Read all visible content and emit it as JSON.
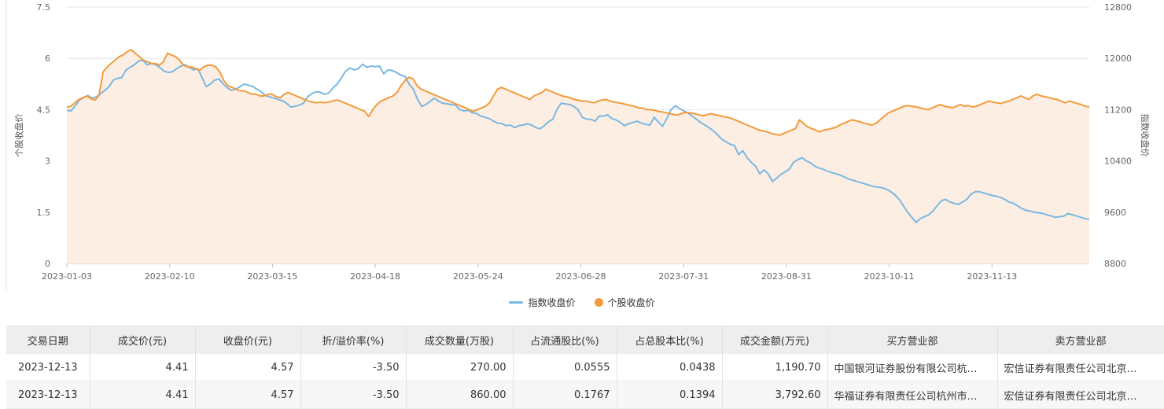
{
  "chart_data": {
    "type": "line",
    "x_ticks": [
      "2023-01-03",
      "2023-02-10",
      "2023-03-15",
      "2023-04-18",
      "2023-05-24",
      "2023-06-28",
      "2023-07-31",
      "2023-08-31",
      "2023-10-11",
      "2023-11-13"
    ],
    "y_left": {
      "label": "个股收盘价",
      "min": 0,
      "max": 7.5,
      "ticks": [
        "0",
        "1.5",
        "3",
        "4.5",
        "6",
        "7.5"
      ]
    },
    "y_right": {
      "label": "指数收盘价",
      "min": 8800,
      "max": 12800,
      "ticks": [
        "8800",
        "9600",
        "10400",
        "11200",
        "12000",
        "12800"
      ]
    },
    "series": [
      {
        "name": "指数收盘价",
        "axis": "right",
        "color": "#7ab8e2",
        "values": [
          11190,
          11180,
          11260,
          11350,
          11390,
          11420,
          11380,
          11400,
          11450,
          11500,
          11560,
          11660,
          11690,
          11700,
          11820,
          11860,
          11900,
          11960,
          11970,
          11900,
          11920,
          11900,
          11860,
          11800,
          11780,
          11790,
          11840,
          11880,
          11900,
          11860,
          11820,
          11840,
          11700,
          11560,
          11600,
          11660,
          11680,
          11600,
          11540,
          11500,
          11520,
          11560,
          11600,
          11580,
          11560,
          11520,
          11480,
          11420,
          11400,
          11380,
          11360,
          11340,
          11300,
          11240,
          11250,
          11270,
          11300,
          11400,
          11450,
          11480,
          11470,
          11440,
          11460,
          11540,
          11600,
          11700,
          11800,
          11850,
          11820,
          11840,
          11910,
          11860,
          11880,
          11870,
          11880,
          11760,
          11820,
          11810,
          11780,
          11740,
          11720,
          11600,
          11520,
          11360,
          11250,
          11280,
          11330,
          11380,
          11330,
          11300,
          11290,
          11280,
          11270,
          11200,
          11180,
          11190,
          11150,
          11140,
          11100,
          11080,
          11060,
          11020,
          10990,
          10980,
          10950,
          10960,
          10920,
          10950,
          10960,
          10980,
          10960,
          10920,
          10900,
          10950,
          11010,
          11050,
          11200,
          11300,
          11290,
          11280,
          11250,
          11200,
          11080,
          11050,
          11050,
          11020,
          11100,
          11100,
          11120,
          11060,
          11040,
          11000,
          10950,
          10980,
          11000,
          11020,
          10990,
          10970,
          10960,
          11080,
          11010,
          10940,
          11060,
          11200,
          11260,
          11220,
          11180,
          11150,
          11100,
          11050,
          11000,
          10960,
          10920,
          10870,
          10810,
          10740,
          10700,
          10660,
          10640,
          10500,
          10560,
          10450,
          10380,
          10320,
          10200,
          10260,
          10200,
          10080,
          10130,
          10190,
          10230,
          10270,
          10380,
          10420,
          10450,
          10400,
          10370,
          10320,
          10290,
          10270,
          10240,
          10220,
          10200,
          10180,
          10150,
          10120,
          10100,
          10080,
          10060,
          10040,
          10020,
          10000,
          9990,
          9980,
          9960,
          9920,
          9870,
          9800,
          9700,
          9600,
          9520,
          9440,
          9500,
          9530,
          9560,
          9620,
          9700,
          9780,
          9800,
          9760,
          9740,
          9720,
          9760,
          9800,
          9880,
          9920,
          9920,
          9900,
          9880,
          9860,
          9850,
          9830,
          9800,
          9760,
          9740,
          9700,
          9660,
          9630,
          9620,
          9600,
          9590,
          9580,
          9560,
          9540,
          9520,
          9530,
          9540,
          9580,
          9560,
          9540,
          9520,
          9500,
          9490
        ],
        "x_range": [
          0,
          1
        ]
      },
      {
        "name": "个股收盘价",
        "axis": "left",
        "color": "#f29b3c",
        "values": [
          4.58,
          4.6,
          4.7,
          4.8,
          4.85,
          4.9,
          4.82,
          4.78,
          4.92,
          5.6,
          5.75,
          5.85,
          5.95,
          6.05,
          6.1,
          6.2,
          6.25,
          6.15,
          6.05,
          5.95,
          5.9,
          5.85,
          5.85,
          5.8,
          5.9,
          6.15,
          6.1,
          6.05,
          5.95,
          5.8,
          5.75,
          5.75,
          5.7,
          5.65,
          5.75,
          5.8,
          5.8,
          5.75,
          5.6,
          5.35,
          5.2,
          5.15,
          5.1,
          5.05,
          5.05,
          5.0,
          4.95,
          4.95,
          4.9,
          4.9,
          4.95,
          4.95,
          4.88,
          4.85,
          4.95,
          5.0,
          4.95,
          4.9,
          4.85,
          4.8,
          4.75,
          4.72,
          4.7,
          4.72,
          4.7,
          4.72,
          4.75,
          4.78,
          4.75,
          4.7,
          4.65,
          4.6,
          4.55,
          4.5,
          4.45,
          4.3,
          4.5,
          4.65,
          4.75,
          4.8,
          4.85,
          4.9,
          5.0,
          5.2,
          5.35,
          5.45,
          5.4,
          5.2,
          5.1,
          5.05,
          5.0,
          4.95,
          4.9,
          4.85,
          4.8,
          4.75,
          4.7,
          4.65,
          4.6,
          4.55,
          4.5,
          4.45,
          4.5,
          4.55,
          4.6,
          4.7,
          4.9,
          5.1,
          5.15,
          5.1,
          5.05,
          5.0,
          4.95,
          4.9,
          4.85,
          4.8,
          4.9,
          4.95,
          5.0,
          5.1,
          5.05,
          5.0,
          4.95,
          4.9,
          4.88,
          4.85,
          4.8,
          4.78,
          4.75,
          4.75,
          4.72,
          4.7,
          4.75,
          4.78,
          4.8,
          4.75,
          4.72,
          4.7,
          4.68,
          4.65,
          4.62,
          4.6,
          4.55,
          4.55,
          4.5,
          4.5,
          4.48,
          4.45,
          4.43,
          4.4,
          4.38,
          4.35,
          4.35,
          4.4,
          4.42,
          4.4,
          4.38,
          4.35,
          4.32,
          4.35,
          4.38,
          4.35,
          4.33,
          4.3,
          4.28,
          4.25,
          4.2,
          4.15,
          4.1,
          4.05,
          4.0,
          3.95,
          3.9,
          3.88,
          3.85,
          3.8,
          3.78,
          3.75,
          3.8,
          3.85,
          3.9,
          3.95,
          4.2,
          4.1,
          4.0,
          3.95,
          3.9,
          3.85,
          3.9,
          3.92,
          3.95,
          3.98,
          4.05,
          4.1,
          4.15,
          4.2,
          4.18,
          4.15,
          4.1,
          4.08,
          4.05,
          4.1,
          4.2,
          4.3,
          4.4,
          4.45,
          4.5,
          4.55,
          4.6,
          4.62,
          4.6,
          4.58,
          4.55,
          4.52,
          4.5,
          4.55,
          4.6,
          4.65,
          4.6,
          4.58,
          4.55,
          4.6,
          4.65,
          4.6,
          4.62,
          4.58,
          4.6,
          4.65,
          4.7,
          4.75,
          4.72,
          4.7,
          4.68,
          4.72,
          4.75,
          4.8,
          4.85,
          4.9,
          4.85,
          4.8,
          4.9,
          4.95,
          4.9,
          4.88,
          4.85,
          4.82,
          4.8,
          4.75,
          4.7,
          4.75,
          4.72,
          4.68,
          4.65,
          4.6,
          4.58
        ],
        "x_range": [
          0,
          1
        ]
      }
    ],
    "grid": true,
    "area_fill": "#fdeee3",
    "legend_position": "bottom-center"
  },
  "legend": {
    "index_label": "指数收盘价",
    "stock_label": "个股收盘价"
  },
  "table": {
    "headers": [
      "交易日期",
      "成交价(元)",
      "收盘价(元)",
      "折/溢价率(%)",
      "成交数量(万股)",
      "占流通股比(%)",
      "占总股本比(%)",
      "成交金额(万元)",
      "买方营业部",
      "卖方营业部"
    ],
    "rows": [
      [
        "2023-12-13",
        "4.41",
        "4.57",
        "-3.50",
        "270.00",
        "0.0555",
        "0.0438",
        "1,190.70",
        "中国银河证券股份有限公司杭…",
        "宏信证券有限责任公司北京…"
      ],
      [
        "2023-12-13",
        "4.41",
        "4.57",
        "-3.50",
        "860.00",
        "0.1767",
        "0.1394",
        "3,792.60",
        "华福证券有限责任公司杭州市…",
        "宏信证券有限责任公司北京…"
      ]
    ]
  }
}
